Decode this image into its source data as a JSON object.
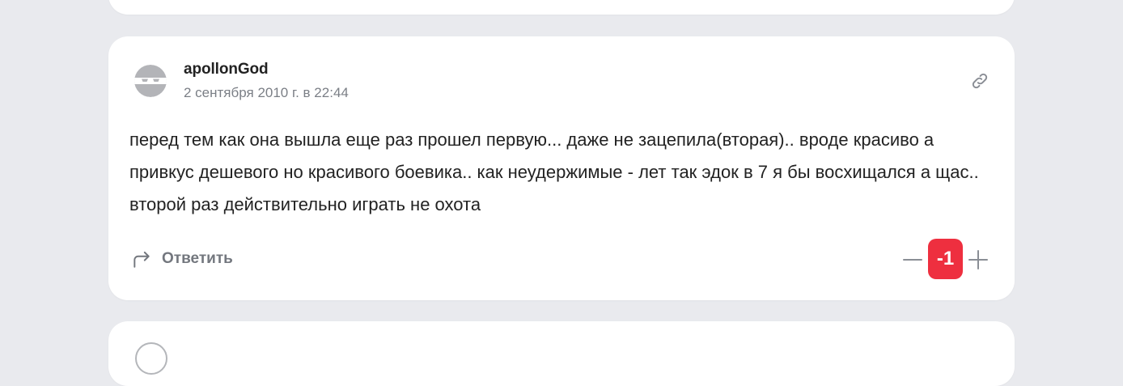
{
  "comment": {
    "author": "apollonGod",
    "date": "2 сентября 2010 г. в 22:44",
    "text": "перед тем как она вышла еще раз прошел первую... даже не зацепила(вторая).. вроде красиво а привкус дешевого но красивого боевика.. как неудержимые - лет так эдок в 7 я бы восхищался а щас.. второй раз действительно играть не охота",
    "reply_label": "Ответить",
    "rating": "-1",
    "avatar_icon": "anonymous-avatar-icon",
    "link_icon": "link-icon"
  },
  "colors": {
    "background": "#e9eaee",
    "card": "#ffffff",
    "rating_negative": "#ee2f3f",
    "muted_text": "#7b7f86"
  }
}
